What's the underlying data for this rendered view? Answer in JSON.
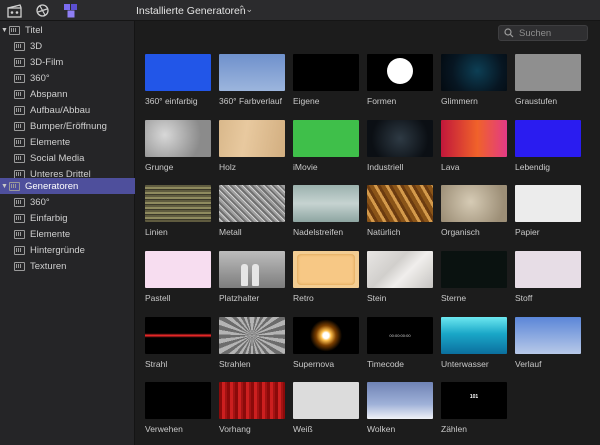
{
  "toolbar": {
    "library_title": "Installierte Generatoren",
    "icons": [
      "clapper-icon",
      "media-browser-icon",
      "titles-generators-icon"
    ]
  },
  "search": {
    "placeholder": "Suchen"
  },
  "sidebar": {
    "groups": [
      {
        "label": "Titel",
        "expanded": true,
        "items": [
          "3D",
          "3D-Film",
          "360°",
          "Abspann",
          "Aufbau/Abbau",
          "Bumper/Eröffnung",
          "Elemente",
          "Social Media",
          "Unteres Drittel"
        ]
      },
      {
        "label": "Generatoren",
        "expanded": true,
        "selected": true,
        "items": [
          "360°",
          "Einfarbig",
          "Elemente",
          "Hintergründe",
          "Texturen"
        ]
      }
    ]
  },
  "grid": {
    "items": [
      "360° einfarbig",
      "360° Farbverlauf",
      "Eigene",
      "Formen",
      "Glimmern",
      "Graustufen",
      "Grunge",
      "Holz",
      "iMovie",
      "Industriell",
      "Lava",
      "Lebendig",
      "Linien",
      "Metall",
      "Nadelstreifen",
      "Natürlich",
      "Organisch",
      "Papier",
      "Pastell",
      "Platzhalter",
      "Retro",
      "Stein",
      "Sterne",
      "Stoff",
      "Strahl",
      "Strahlen",
      "Supernova",
      "Timecode",
      "Unterwasser",
      "Verlauf",
      "Verwehen",
      "Vorhang",
      "Weiß",
      "Wolken",
      "Zählen"
    ],
    "timecode_overlay": "00:00:00:00",
    "zaehlen_overlay": "101"
  },
  "colors": {
    "selection": "#4e4f9c",
    "background": "#1c1c1c",
    "sidebar": "#252527"
  }
}
